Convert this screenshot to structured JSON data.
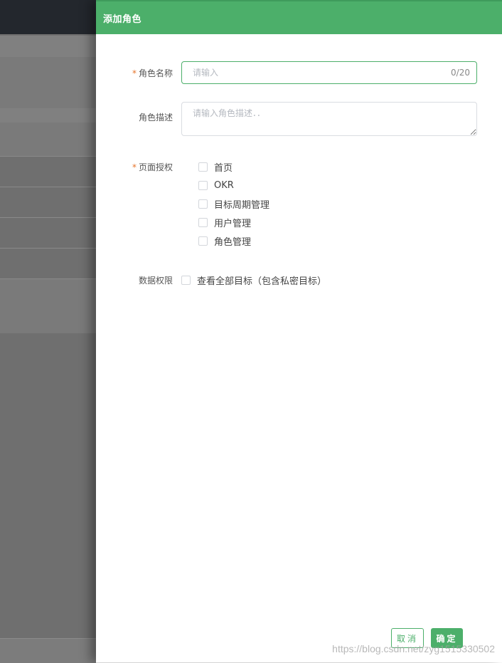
{
  "drawer": {
    "title": "添加角色"
  },
  "form": {
    "role_name": {
      "required_mark": "*",
      "label": "角色名称",
      "value": "",
      "placeholder": "请输入",
      "counter": "0/20"
    },
    "role_desc": {
      "label": "角色描述",
      "value": "",
      "placeholder": "请输入角色描述．．"
    },
    "page_auth": {
      "required_mark": "*",
      "label": "页面授权",
      "options": [
        {
          "label": "首页",
          "checked": false
        },
        {
          "label": "OKR",
          "checked": false
        },
        {
          "label": "目标周期管理",
          "checked": false
        },
        {
          "label": "用户管理",
          "checked": false
        },
        {
          "label": "角色管理",
          "checked": false
        }
      ]
    },
    "data_auth": {
      "label": "数据权限",
      "option": {
        "label": "查看全部目标（包含私密目标）",
        "checked": false
      }
    }
  },
  "footer": {
    "cancel_label": "取消",
    "confirm_label": "确定"
  },
  "watermark": "https://blog.csdn.net/zyg1515330502",
  "colors": {
    "accent": "#4caf6a",
    "required": "#e6742a",
    "mask": "#6f6f6f",
    "topbar": "#23272d"
  }
}
